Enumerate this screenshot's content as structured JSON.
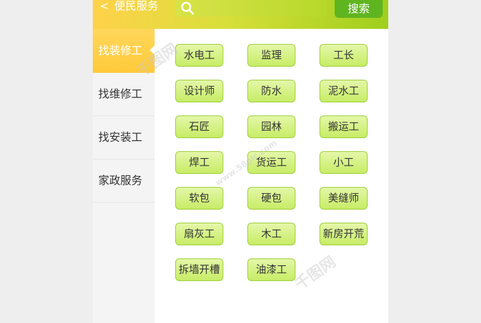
{
  "header": {
    "back_label": "‹",
    "title": "便民服务",
    "search_button": "搜索"
  },
  "sidebar": {
    "items": [
      {
        "label": "找装修工",
        "active": true
      },
      {
        "label": "找维修工",
        "active": false
      },
      {
        "label": "找安装工",
        "active": false
      },
      {
        "label": "家政服务",
        "active": false
      }
    ]
  },
  "services": [
    "水电工",
    "监理",
    "工长",
    "设计师",
    "防水",
    "泥水工",
    "石匠",
    "园林",
    "搬运工",
    "焊工",
    "货运工",
    "小工",
    "软包",
    "硬包",
    "美缝师",
    "扇灰工",
    "木工",
    "新房开荒",
    "拆墙开槽",
    "油漆工"
  ],
  "watermark": {
    "text": "千图网",
    "url": "www.58pic.com"
  },
  "colors": {
    "accent_yellow": "#ffd24a",
    "accent_green": "#5fb520",
    "tag_border": "#9fcf3a"
  }
}
